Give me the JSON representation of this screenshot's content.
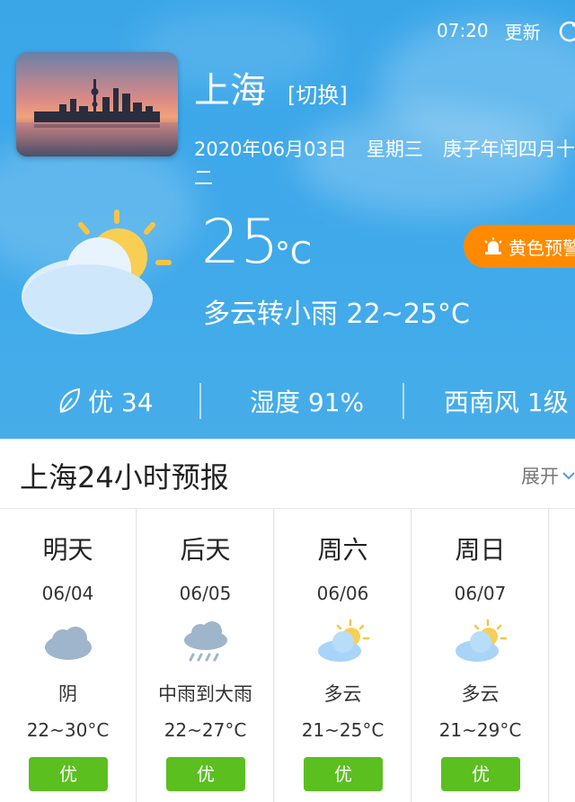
{
  "header": {
    "time": "07:20",
    "refresh_label": "更新",
    "city": "上海",
    "switch_label": "[切换]",
    "date": "2020年06月03日",
    "weekday": "星期三",
    "lunar": "庚子年闰四月十二"
  },
  "current": {
    "temperature": "25",
    "unit": "°C",
    "description": "多云转小雨 22~25°C",
    "alert": "黄色预警"
  },
  "stats": {
    "air_quality": "优 34",
    "humidity": "湿度 91%",
    "wind": "西南风 1级"
  },
  "forecast_section": {
    "title": "上海24小时预报",
    "expand_label": "展开"
  },
  "forecast": [
    {
      "day": "明天",
      "date": "06/04",
      "condition": "阴",
      "range": "22~30°C",
      "aqi": "优",
      "icon": "overcast-cloud-icon"
    },
    {
      "day": "后天",
      "date": "06/05",
      "condition": "中雨到大雨",
      "range": "22~27°C",
      "aqi": "优",
      "icon": "rain-cloud-icon"
    },
    {
      "day": "周六",
      "date": "06/06",
      "condition": "多云",
      "range": "21~25°C",
      "aqi": "优",
      "icon": "partly-cloudy-icon"
    },
    {
      "day": "周日",
      "date": "06/07",
      "condition": "多云",
      "range": "21~29°C",
      "aqi": "优",
      "icon": "partly-cloudy-icon"
    }
  ],
  "colors": {
    "sky": "#3ea8ea",
    "alert": "#ff8a00",
    "aqi_good": "#5bbf1f"
  }
}
